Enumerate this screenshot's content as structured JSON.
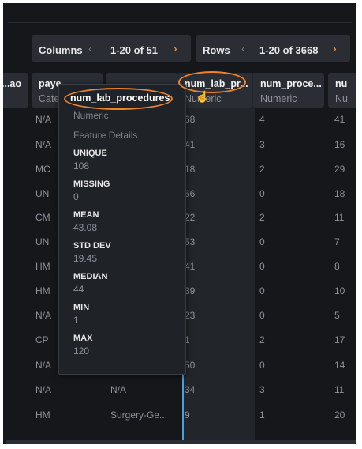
{
  "pagination": {
    "columns": {
      "label": "Columns",
      "range": "1-20 of 51"
    },
    "rows": {
      "label": "Rows",
      "range": "1-20 of 3668"
    },
    "prev_icon": "‹",
    "next_icon": "›"
  },
  "columns": [
    {
      "name": "...ao",
      "type": ""
    },
    {
      "name": "paye",
      "type": "Cate"
    },
    {
      "name": "num_lab_pr...",
      "type": "Numeric"
    },
    {
      "name": "num_proce...",
      "type": "Numeric"
    },
    {
      "name": "nu",
      "type": "Nu"
    }
  ],
  "col_payer": [
    "N/A",
    "N/A",
    "MC",
    "UN",
    "CM",
    "UN",
    "HM",
    "HM",
    "N/A",
    "CP",
    "N/A",
    "N/A",
    "HM"
  ],
  "col_hidden_visible": [
    "N/A",
    "Surgery-Ge..."
  ],
  "col_num_lab": [
    "68",
    "41",
    "18",
    "66",
    "22",
    "53",
    "41",
    "39",
    "23",
    "1",
    "50",
    "34",
    "9"
  ],
  "col_num_proc": [
    "4",
    "3",
    "2",
    "0",
    "2",
    "0",
    "0",
    "0",
    "0",
    "2",
    "0",
    "3",
    "1"
  ],
  "col_partial": [
    "41",
    "16",
    "29",
    "18",
    "11",
    "7",
    "8",
    "10",
    "5",
    "17",
    "14",
    "11",
    "20"
  ],
  "popup": {
    "title": "num_lab_procedures",
    "type": "Numeric",
    "section": "Feature Details",
    "stats": [
      {
        "label": "UNIQUE",
        "value": "108"
      },
      {
        "label": "MISSING",
        "value": "0"
      },
      {
        "label": "MEAN",
        "value": "43.08"
      },
      {
        "label": "STD DEV",
        "value": "19.45"
      },
      {
        "label": "MEDIAN",
        "value": "44"
      },
      {
        "label": "MIN",
        "value": "1"
      },
      {
        "label": "MAX",
        "value": "120"
      }
    ]
  },
  "colors": {
    "accent": "#f0842c",
    "selected": "#4a9fe0"
  }
}
